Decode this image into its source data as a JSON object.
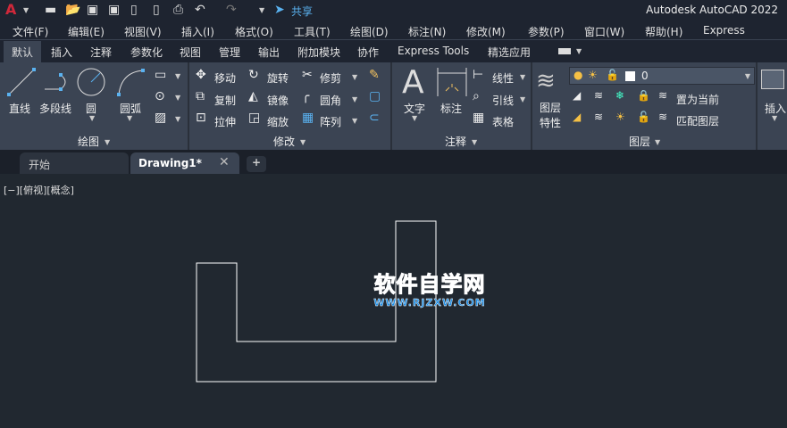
{
  "titlebar": {
    "app_title": "Autodesk AutoCAD 2022",
    "share_label": "共享"
  },
  "menubar": [
    "文件(F)",
    "编辑(E)",
    "视图(V)",
    "插入(I)",
    "格式(O)",
    "工具(T)",
    "绘图(D)",
    "标注(N)",
    "修改(M)",
    "参数(P)",
    "窗口(W)",
    "帮助(H)",
    "Express"
  ],
  "ribbon_tabs": [
    "默认",
    "插入",
    "注释",
    "参数化",
    "视图",
    "管理",
    "输出",
    "附加模块",
    "协作",
    "Express Tools",
    "精选应用"
  ],
  "active_tab": "默认",
  "panels": {
    "draw": {
      "title": "绘图",
      "tools": [
        "直线",
        "多段线",
        "圆",
        "圆弧"
      ]
    },
    "modify": {
      "title": "修改",
      "tools": [
        "移动",
        "旋转",
        "修剪",
        "复制",
        "镜像",
        "圆角",
        "拉伸",
        "缩放",
        "阵列"
      ]
    },
    "annotation": {
      "title": "注释",
      "tools": [
        "文字",
        "标注",
        "线性",
        "引线",
        "表格"
      ]
    },
    "layers": {
      "title": "图层",
      "properties_label": "图层特性",
      "layer_value": "0",
      "set_current": "置为当前",
      "match_layer": "匹配图层"
    },
    "block": {
      "insert": "插入"
    }
  },
  "doc_tabs": [
    {
      "label": "开始",
      "active": false
    },
    {
      "label": "Drawing1*",
      "active": true
    }
  ],
  "viewport": {
    "label": "[−][俯视][概念]"
  },
  "watermark": {
    "text": "软件自学网",
    "url": "WWW.RJZXW.COM"
  },
  "colors": {
    "canvas": "#212830",
    "ribbon": "#3b4453",
    "accent": "#5ab2f0",
    "logo_red": "#c8102e"
  }
}
